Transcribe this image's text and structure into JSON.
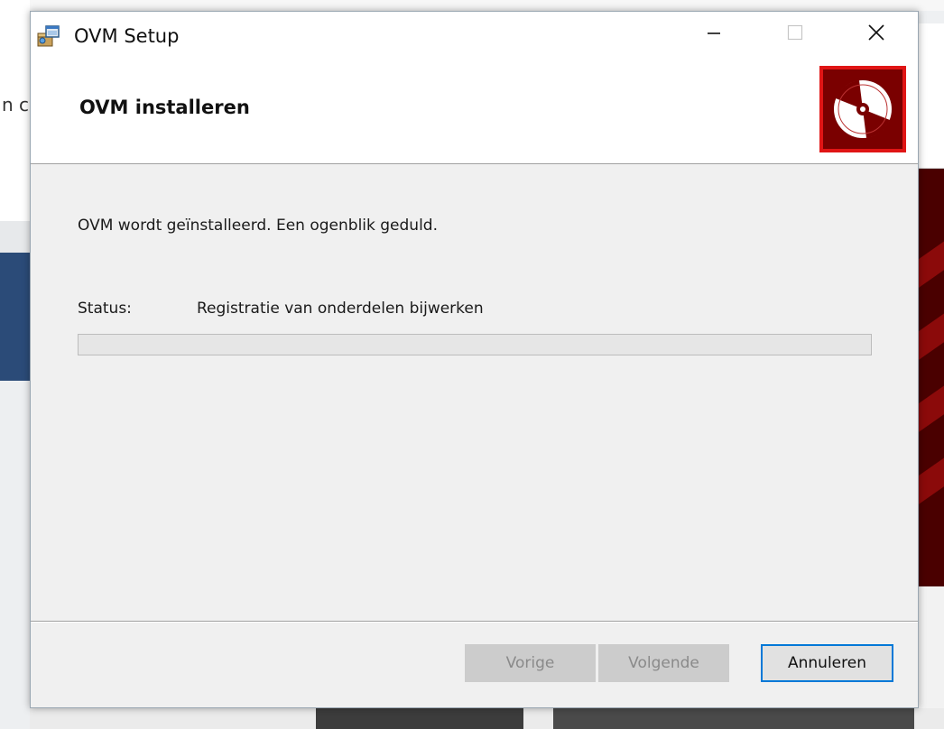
{
  "background": {
    "left_text": "n c"
  },
  "window": {
    "title": "OVM Setup",
    "app_icon": "installer-package-icon",
    "controls": {
      "minimize_icon": "minimize-icon",
      "maximize_icon": "maximize-icon",
      "close_icon": "close-icon"
    }
  },
  "header": {
    "title": "OVM installeren",
    "banner_icon": "disc-icon"
  },
  "body": {
    "description": "OVM wordt geïnstalleerd. Een ogenblik geduld.",
    "status_label": "Status:",
    "status_value": "Registratie van onderdelen bijwerken",
    "progress_percent": 0
  },
  "buttons": {
    "back": "Vorige",
    "next": "Volgende",
    "cancel": "Annuleren"
  },
  "colors": {
    "accent": "#0078d7",
    "banner_red": "#c40000"
  }
}
